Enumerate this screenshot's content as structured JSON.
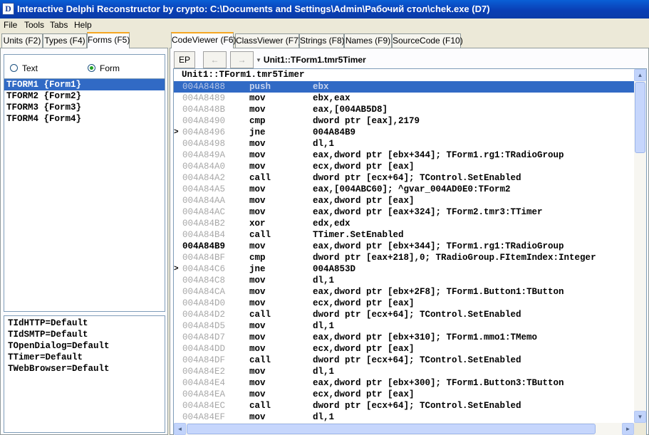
{
  "window": {
    "title": "Interactive Delphi Reconstructor by crypto: C:\\Documents and Settings\\Admin\\Рабочий стол\\chek.exe (D7)",
    "icon_letter": "D"
  },
  "menu": [
    "File",
    "Tools",
    "Tabs",
    "Help"
  ],
  "left_tabs": [
    "Units (F2)",
    "Types (F4)",
    "Forms (F5)"
  ],
  "left_active_tab": 2,
  "radio": {
    "text_label": "Text",
    "form_label": "Form",
    "selected": "Form"
  },
  "forms": [
    {
      "label": "TFORM1 {Form1}",
      "selected": true
    },
    {
      "label": "TFORM2 {Form2}",
      "selected": false
    },
    {
      "label": "TFORM3 {Form3}",
      "selected": false
    },
    {
      "label": "TFORM4 {Form4}",
      "selected": false
    }
  ],
  "properties": [
    "TIdHTTP=Default",
    "TIdSMTP=Default",
    "TOpenDialog=Default",
    "TTimer=Default",
    "TWebBrowser=Default"
  ],
  "right_tabs": [
    "CodeViewer (F6)",
    "ClassViewer (F7)",
    "Strings (F8)",
    "Names (F9)",
    "SourceCode (F10)"
  ],
  "right_active_tab": 0,
  "toolbar": {
    "ep_label": "EP",
    "back_label": "←",
    "forward_label": "→",
    "path_arrow": "▼",
    "path": "Unit1::TForm1.tmr5Timer"
  },
  "code": {
    "header": "Unit1::TForm1.tmr5Timer",
    "rows": [
      {
        "addr": "004A8488",
        "mn": "push",
        "ops": "ebx",
        "selected": true,
        "jump": false,
        "target": false
      },
      {
        "addr": "004A8489",
        "mn": "mov",
        "ops": "ebx,eax",
        "selected": false,
        "jump": false,
        "target": false
      },
      {
        "addr": "004A848B",
        "mn": "mov",
        "ops": "eax,[004AB5D8]",
        "selected": false,
        "jump": false,
        "target": false
      },
      {
        "addr": "004A8490",
        "mn": "cmp",
        "ops": "dword ptr [eax],2179",
        "selected": false,
        "jump": false,
        "target": false
      },
      {
        "addr": "004A8496",
        "mn": "jne",
        "ops": "004A84B9",
        "selected": false,
        "jump": true,
        "target": false
      },
      {
        "addr": "004A8498",
        "mn": "mov",
        "ops": "dl,1",
        "selected": false,
        "jump": false,
        "target": false
      },
      {
        "addr": "004A849A",
        "mn": "mov",
        "ops": "eax,dword ptr [ebx+344]; TForm1.rg1:TRadioGroup",
        "selected": false,
        "jump": false,
        "target": false
      },
      {
        "addr": "004A84A0",
        "mn": "mov",
        "ops": "ecx,dword ptr [eax]",
        "selected": false,
        "jump": false,
        "target": false
      },
      {
        "addr": "004A84A2",
        "mn": "call",
        "ops": "dword ptr [ecx+64]; TControl.SetEnabled",
        "selected": false,
        "jump": false,
        "target": false
      },
      {
        "addr": "004A84A5",
        "mn": "mov",
        "ops": "eax,[004ABC60]; ^gvar_004AD0E0:TForm2",
        "selected": false,
        "jump": false,
        "target": false
      },
      {
        "addr": "004A84AA",
        "mn": "mov",
        "ops": "eax,dword ptr [eax]",
        "selected": false,
        "jump": false,
        "target": false
      },
      {
        "addr": "004A84AC",
        "mn": "mov",
        "ops": "eax,dword ptr [eax+324]; TForm2.tmr3:TTimer",
        "selected": false,
        "jump": false,
        "target": false
      },
      {
        "addr": "004A84B2",
        "mn": "xor",
        "ops": "edx,edx",
        "selected": false,
        "jump": false,
        "target": false
      },
      {
        "addr": "004A84B4",
        "mn": "call",
        "ops": "TTimer.SetEnabled",
        "selected": false,
        "jump": false,
        "target": false
      },
      {
        "addr": "004A84B9",
        "mn": "mov",
        "ops": "eax,dword ptr [ebx+344]; TForm1.rg1:TRadioGroup",
        "selected": false,
        "jump": false,
        "target": true
      },
      {
        "addr": "004A84BF",
        "mn": "cmp",
        "ops": "dword ptr [eax+218],0; TRadioGroup.FItemIndex:Integer",
        "selected": false,
        "jump": false,
        "target": false
      },
      {
        "addr": "004A84C6",
        "mn": "jne",
        "ops": "004A853D",
        "selected": false,
        "jump": true,
        "target": false
      },
      {
        "addr": "004A84C8",
        "mn": "mov",
        "ops": "dl,1",
        "selected": false,
        "jump": false,
        "target": false
      },
      {
        "addr": "004A84CA",
        "mn": "mov",
        "ops": "eax,dword ptr [ebx+2F8]; TForm1.Button1:TButton",
        "selected": false,
        "jump": false,
        "target": false
      },
      {
        "addr": "004A84D0",
        "mn": "mov",
        "ops": "ecx,dword ptr [eax]",
        "selected": false,
        "jump": false,
        "target": false
      },
      {
        "addr": "004A84D2",
        "mn": "call",
        "ops": "dword ptr [ecx+64]; TControl.SetEnabled",
        "selected": false,
        "jump": false,
        "target": false
      },
      {
        "addr": "004A84D5",
        "mn": "mov",
        "ops": "dl,1",
        "selected": false,
        "jump": false,
        "target": false
      },
      {
        "addr": "004A84D7",
        "mn": "mov",
        "ops": "eax,dword ptr [ebx+310]; TForm1.mmo1:TMemo",
        "selected": false,
        "jump": false,
        "target": false
      },
      {
        "addr": "004A84DD",
        "mn": "mov",
        "ops": "ecx,dword ptr [eax]",
        "selected": false,
        "jump": false,
        "target": false
      },
      {
        "addr": "004A84DF",
        "mn": "call",
        "ops": "dword ptr [ecx+64]; TControl.SetEnabled",
        "selected": false,
        "jump": false,
        "target": false
      },
      {
        "addr": "004A84E2",
        "mn": "mov",
        "ops": "dl,1",
        "selected": false,
        "jump": false,
        "target": false
      },
      {
        "addr": "004A84E4",
        "mn": "mov",
        "ops": "eax,dword ptr [ebx+300]; TForm1.Button3:TButton",
        "selected": false,
        "jump": false,
        "target": false
      },
      {
        "addr": "004A84EA",
        "mn": "mov",
        "ops": "ecx,dword ptr [eax]",
        "selected": false,
        "jump": false,
        "target": false
      },
      {
        "addr": "004A84EC",
        "mn": "call",
        "ops": "dword ptr [ecx+64]; TControl.SetEnabled",
        "selected": false,
        "jump": false,
        "target": false
      },
      {
        "addr": "004A84EF",
        "mn": "mov",
        "ops": "dl,1",
        "selected": false,
        "jump": false,
        "target": false
      }
    ]
  },
  "icons": {
    "app": "app-icon",
    "jump_marker": ">",
    "scroll_up": "▲",
    "scroll_down": "▼",
    "scroll_left": "◄",
    "scroll_right": "►"
  },
  "colors": {
    "titlebar": "#0a4fc8",
    "selection": "#316ac5",
    "active_tab_accent": "#f5a623",
    "address_gray": "#a8a8a8"
  }
}
